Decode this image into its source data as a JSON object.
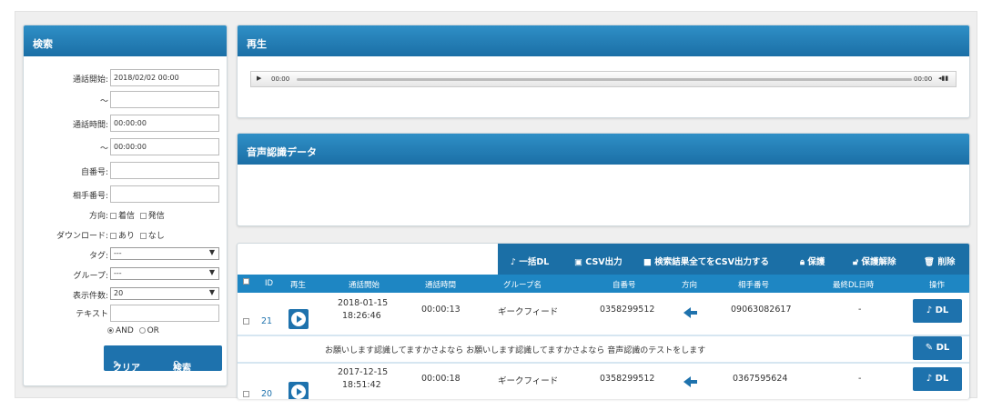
{
  "search": {
    "title": "検索",
    "call_start_label": "通話開始:",
    "call_start_from": "2018/02/02 00:00",
    "call_start_to": "",
    "tilde": "～",
    "call_time_label": "通話時間:",
    "call_time_from": "00:00:00",
    "call_time_to": "00:00:00",
    "own_number_label": "自番号:",
    "own_number": "",
    "partner_number_label": "相手番号:",
    "partner_number": "",
    "direction_label": "方向:",
    "direction_incoming": "着信",
    "direction_outgoing": "発信",
    "download_label": "ダウンロード:",
    "download_yes": "あり",
    "download_no": "なし",
    "tag_label": "タグ:",
    "tag_value": "---",
    "group_label": "グループ:",
    "group_value": "---",
    "count_label": "表示件数:",
    "count_value": "20",
    "text_label": "テキスト",
    "text_value": "",
    "and_label": "AND",
    "or_label": "OR",
    "clear_button": "クリア",
    "search_button": "検索"
  },
  "player": {
    "title": "再生",
    "current_time": "00:00",
    "total_time": "00:00"
  },
  "voice": {
    "title": "音声認識データ"
  },
  "toolbar": {
    "bulk_dl": "一括DL",
    "csv": "CSV出力",
    "csv_all": "検索結果全てをCSV出力する",
    "protect": "保護",
    "unprotect": "保護解除",
    "delete": "削除"
  },
  "table": {
    "headers": [
      "ID",
      "再生",
      "通話開始",
      "通話時間",
      "グループ名",
      "自番号",
      "方向",
      "相手番号",
      "最終DL日時",
      "操作"
    ],
    "rows": [
      {
        "id": "21",
        "date": "2018-01-15",
        "time": "18:26:46",
        "duration": "00:00:13",
        "group": "ギークフィード",
        "own": "0358299512",
        "partner": "09063082617",
        "last_dl": "-",
        "action": "DL",
        "transcript": "お願いします認識してますかさよなら お願いします認識してますかさよなら 音声認識のテストをします",
        "transcript_action": "DL"
      },
      {
        "id": "20",
        "date": "2017-12-15",
        "time": "18:51:42",
        "duration": "00:00:18",
        "group": "ギークフィード",
        "own": "0358299512",
        "partner": "0367595624",
        "last_dl": "-",
        "action": "DL"
      }
    ]
  },
  "colors": {
    "header_blue": "#1b6fa6",
    "table_header": "#1e86c3",
    "button_blue": "#1e72ad"
  }
}
